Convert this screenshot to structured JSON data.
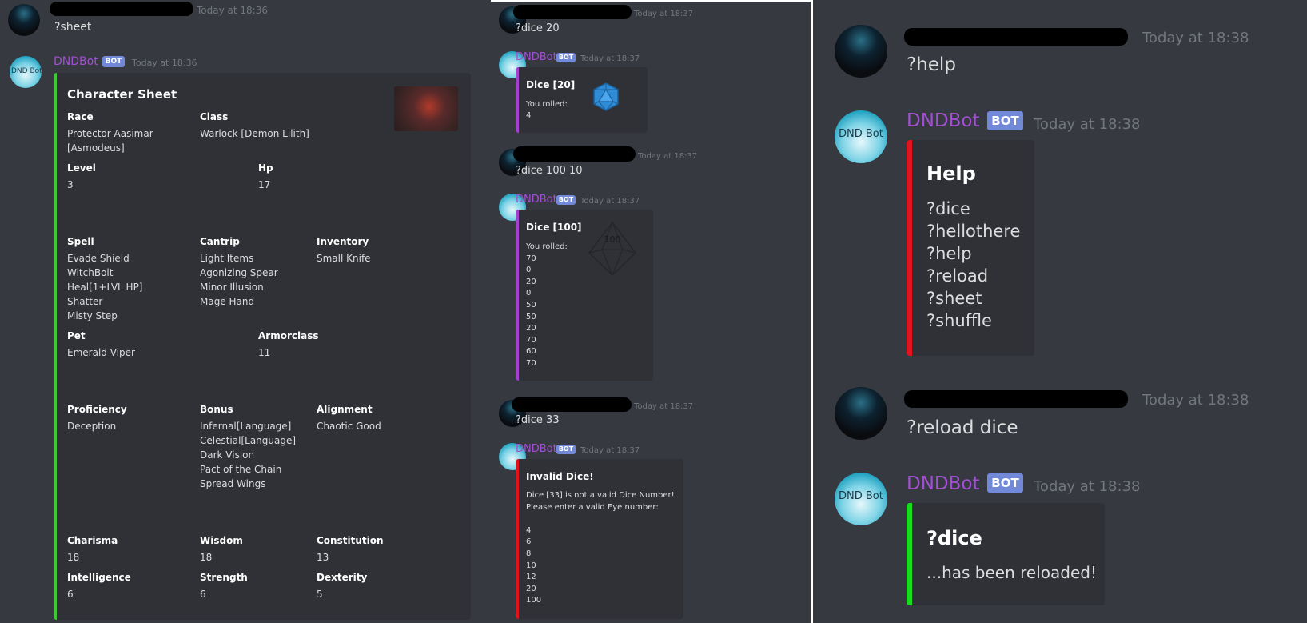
{
  "colors": {
    "background": "#36393f",
    "embed_background": "#2f3136",
    "bot_name": "#a24fd3",
    "bot_tag": "#7289da",
    "timestamp": "#72767d",
    "text": "#dcddde",
    "accent_green": "#3ec832",
    "accent_purple": "#a43fcf",
    "accent_red": "#e0141e"
  },
  "bot": {
    "name": "DNDBot",
    "tag": "BOT",
    "avatar_text": "DND Bot"
  },
  "panel1": {
    "user_msg": {
      "time": "Today at 18:36",
      "text": "?sheet"
    },
    "bot_msg": {
      "time": "Today at 18:36"
    },
    "sheet": {
      "title": "Character Sheet",
      "race": {
        "name": "Race",
        "value": "Protector Aasimar\n[Asmodeus]"
      },
      "class": {
        "name": "Class",
        "value": "Warlock [Demon Lilith]"
      },
      "level": {
        "name": "Level",
        "value": "3"
      },
      "hp": {
        "name": "Hp",
        "value": "17"
      },
      "spell": {
        "name": "Spell",
        "value": "Evade Shield\nWitchBolt\nHeal[1+LVL HP]\nShatter\nMisty Step"
      },
      "cantrip": {
        "name": "Cantrip",
        "value": "Light Items\nAgonizing Spear\nMinor Illusion\nMage Hand"
      },
      "inventory": {
        "name": "Inventory",
        "value": "Small Knife"
      },
      "pet": {
        "name": "Pet",
        "value": "Emerald Viper"
      },
      "armorclass": {
        "name": "Armorclass",
        "value": "11"
      },
      "proficiency": {
        "name": "Proficiency",
        "value": "Deception"
      },
      "bonus": {
        "name": "Bonus",
        "value": "Infernal[Language]\nCelestial[Language]\nDark Vision\nPact of the Chain\nSpread Wings"
      },
      "alignment": {
        "name": "Alignment",
        "value": "Chaotic Good"
      },
      "charisma": {
        "name": "Charisma",
        "value": "18"
      },
      "wisdom": {
        "name": "Wisdom",
        "value": "18"
      },
      "constitution": {
        "name": "Constitution",
        "value": "13"
      },
      "intelligence": {
        "name": "Intelligence",
        "value": "6"
      },
      "strength": {
        "name": "Strength",
        "value": "6"
      },
      "dexterity": {
        "name": "Dexterity",
        "value": "5"
      }
    }
  },
  "panel2": {
    "msg1": {
      "time": "Today at 18:37",
      "text": "?dice 20"
    },
    "bot1": {
      "time": "Today at 18:37",
      "title": "Dice [20]",
      "body": "You rolled:\n4"
    },
    "msg2": {
      "time": "Today at 18:37",
      "text": "?dice 100 10"
    },
    "bot2": {
      "time": "Today at 18:37",
      "title": "Dice [100]",
      "body": "You rolled:\n70\n0\n20\n0\n50\n50\n20\n70\n60\n70",
      "die_label": "100"
    },
    "msg3": {
      "time": "Today at 18:37",
      "text": "?dice 33"
    },
    "bot3": {
      "time": "Today at 18:37",
      "title": "Invalid Dice!",
      "body": "Dice [33] is not a valid Dice Number!\nPlease enter a valid Eye number:\n\n4\n6\n8\n10\n12\n20\n100"
    }
  },
  "panel3": {
    "msg1": {
      "time": "Today at 18:38",
      "text": "?help"
    },
    "bot1": {
      "time": "Today at 18:38",
      "title": "Help",
      "body": "?dice\n?hellothere\n?help\n?reload\n?sheet\n?shuffle"
    },
    "msg2": {
      "time": "Today at 18:38",
      "text": "?reload dice"
    },
    "bot2": {
      "time": "Today at 18:38",
      "title": "?dice",
      "body": "...has been reloaded!"
    }
  }
}
